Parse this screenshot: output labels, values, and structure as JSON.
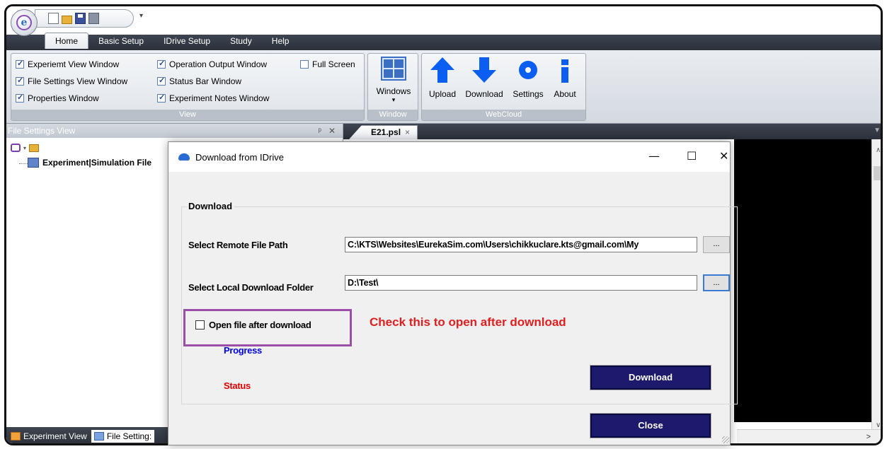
{
  "ribbon": {
    "tabs": [
      "Home",
      "Basic Setup",
      "IDrive Setup",
      "Study",
      "Help"
    ],
    "view_group": {
      "label": "View",
      "options": [
        {
          "label": "Experiemt View Window",
          "checked": true
        },
        {
          "label": "Operation Output Window",
          "checked": true
        },
        {
          "label": "Full Screen",
          "checked": false
        },
        {
          "label": "File Settings View Window",
          "checked": true
        },
        {
          "label": "Status Bar Window",
          "checked": true
        },
        {
          "label": "Properties Window",
          "checked": true
        },
        {
          "label": "Experiment Notes Window",
          "checked": true
        }
      ]
    },
    "window_group": {
      "label": "Window",
      "windows_button": "Windows",
      "windows_arrow": "▾"
    },
    "webcloud_group": {
      "label": "WebCloud",
      "upload": "Upload",
      "download": "Download",
      "settings": "Settings",
      "about": "About"
    }
  },
  "left_panel": {
    "title": "File Settings View",
    "pin": "ᵖ",
    "close": "✕",
    "tree_item": "Experiment|Simulation File"
  },
  "doc_tab": {
    "label": "E21.psl",
    "close": "×"
  },
  "bottom_tabs": {
    "experiment_view": "Experiment View",
    "file_settings": "File Setting:"
  },
  "dialog": {
    "title": "Download from IDrive",
    "minimize": "—",
    "maximize": "☐",
    "close": "✕",
    "group_label": "Download",
    "remote_path_label": "Select Remote File Path",
    "remote_path_value": "C:\\KTS\\Websites\\EurekaSim.com\\Users\\chikkuclare.kts@gmail.com\\My",
    "local_folder_label": "Select Local Download Folder",
    "local_folder_value": "D:\\Test\\",
    "browse_label": "...",
    "open_after_label": "Open file after download",
    "open_after_checked": false,
    "progress_label": "Progress",
    "status_label": "Status",
    "download_button": "Download",
    "close_button": "Close"
  },
  "annotation": {
    "text": "Check this to open after download",
    "color": "#e02020"
  },
  "colors": {
    "accent_icon": "#0a5ef2",
    "button_navy": "#1d1a6e",
    "highlight_box": "#9a4ea8"
  }
}
